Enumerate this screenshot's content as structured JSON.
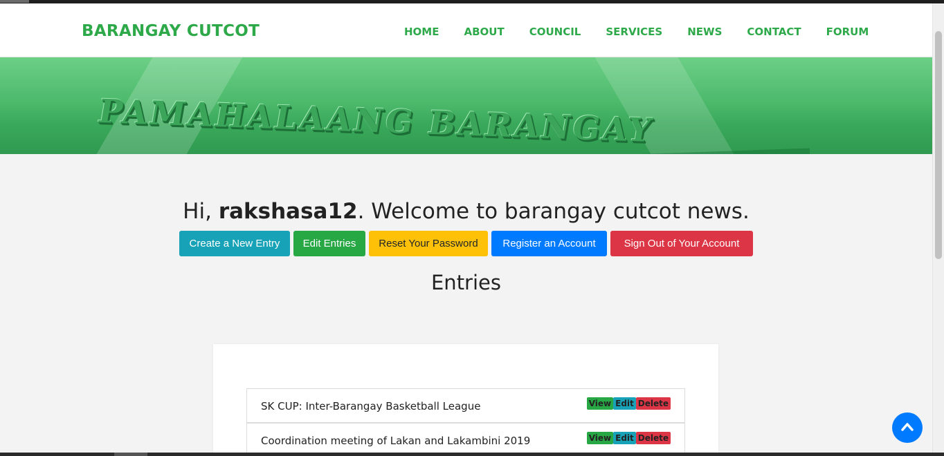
{
  "brand": "BARANGAY CUTCOT",
  "nav": [
    "HOME",
    "ABOUT",
    "COUNCIL",
    "SERVICES",
    "NEWS",
    "CONTACT",
    "FORUM"
  ],
  "hero": {
    "sign_text": "PAMAHALAANG BARANGAY"
  },
  "welcome": {
    "prefix": "Hi, ",
    "username": "rakshasa12",
    "suffix": ". Welcome to barangay cutcot news."
  },
  "buttons": {
    "create": "Create a New Entry",
    "edit": "Edit Entries",
    "reset": "Reset Your Password",
    "register": "Register an Account",
    "signout": "Sign Out of Your Account"
  },
  "entries_title": "Entries",
  "entries": [
    {
      "title": "SK CUP: Inter-Barangay Basketball League",
      "view": "View",
      "edit": "Edit",
      "delete": "Delete"
    },
    {
      "title": "Coordination meeting of Lakan and Lakambini 2019",
      "view": "View",
      "edit": "Edit",
      "delete": "Delete"
    }
  ],
  "icons": {
    "scroll_top": "chevron-up-icon"
  },
  "colors": {
    "brand_green": "#2ea94a",
    "info": "#17a2b8",
    "success": "#28a745",
    "warning": "#ffc107",
    "primary": "#007bff",
    "danger": "#dc3545"
  }
}
